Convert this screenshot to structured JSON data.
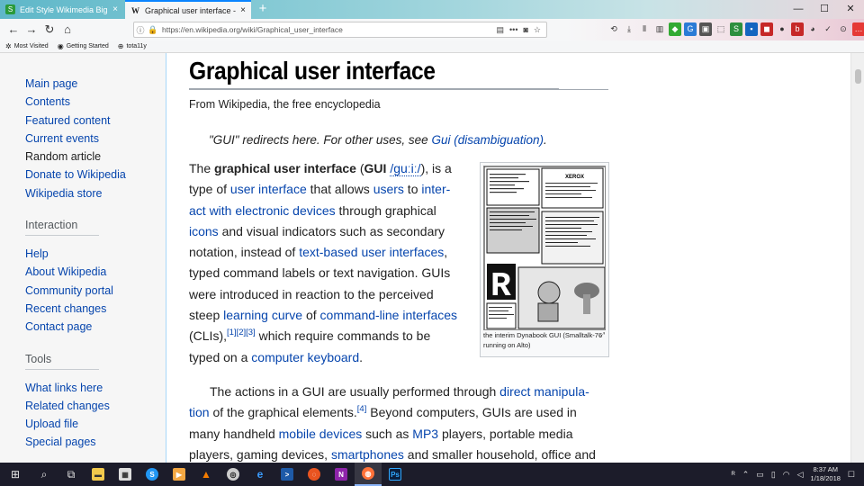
{
  "browser": {
    "tabs": [
      {
        "label": "Edit Style Wikimedia Big Fonts",
        "close": "×",
        "active": false
      },
      {
        "label": "Graphical user interface - Wikip",
        "close": "×",
        "active": true
      }
    ],
    "new_tab": "+",
    "window_controls": {
      "minimize": "—",
      "maximize": "☐",
      "close": "✕"
    },
    "url": "https://en.wikipedia.org/wiki/Graphical_user_interface",
    "url_more": "•••",
    "bookmarks": [
      "Most Visited",
      "Getting Started",
      "tota11y"
    ],
    "accent": "#0a84ff"
  },
  "sidebar": {
    "nav": [
      "Main page",
      "Contents",
      "Featured content",
      "Current events",
      "Random article",
      "Donate to Wikipedia",
      "Wikipedia store"
    ],
    "interaction_heading": "Interaction",
    "interaction": [
      "Help",
      "About Wikipedia",
      "Community portal",
      "Recent changes",
      "Contact page"
    ],
    "tools_heading": "Tools",
    "tools": [
      "What links here",
      "Related changes",
      "Upload file",
      "Special pages"
    ]
  },
  "article": {
    "title": "Graphical user interface",
    "from": "From Wikipedia, the free encyclopedia",
    "hatnote_pre": "\"GUI\" redirects here. For other uses, see ",
    "hatnote_link": "Gui (disambiguation)",
    "hatnote_post": ".",
    "p1": {
      "l1_a": "The ",
      "l1_b": "graphical user interface",
      "l1_c": " (",
      "l1_d": "GUI",
      "l1_e": " ",
      "l1_f": "/ɡuːiː/",
      "l1_g": "), is a",
      "l2_a": "type of ",
      "l2_b": "user interface",
      "l2_c": " that allows ",
      "l2_d": "users",
      "l2_e": " to ",
      "l2_f": "inter-",
      "l3_a": "act with electronic devices",
      "l3_b": " through graphical",
      "l4_a": "icons",
      "l4_b": " and visual indicators such as secondary",
      "l5_a": "notation, instead of ",
      "l5_b": "text-based user interfaces",
      "l5_c": ",",
      "l6": "typed command labels or text navigation. GUIs",
      "l7": "were introduced in reaction to the perceived",
      "l8_a": "steep ",
      "l8_b": "learning curve",
      "l8_c": " of ",
      "l8_d": "command-line interfaces",
      "l9_a": "(CLIs),",
      "l9_r1": "[1]",
      "l9_r2": "[2]",
      "l9_r3": "[3]",
      "l9_b": " which require commands to be",
      "l10_a": "typed on a ",
      "l10_b": "computer keyboard",
      "l10_c": "."
    },
    "p2": {
      "l1_a": "The actions in a GUI are usually performed through ",
      "l1_b": "direct manipula-",
      "l2_a": "tion",
      "l2_b": " of the graphical elements.",
      "l2_r": "[4]",
      "l2_c": " Beyond computers, GUIs are used in",
      "l3_a": "many handheld ",
      "l3_b": "mobile devices",
      "l3_c": " such as ",
      "l3_d": "MP3",
      "l3_e": " players, portable media",
      "l4_a": "players, gaming devices, ",
      "l4_b": "smartphones",
      "l4_c": " and smaller household, office and"
    },
    "figure": {
      "caption": "the interim Dynabook GUI (Smalltalk-76 running on Alto)",
      "logo_text": "XEROX",
      "big_letter": "R"
    }
  },
  "taskbar": {
    "time": "8:37 AM",
    "date": "1/18/2018"
  },
  "colors": {
    "link": "#0645ad",
    "text": "#222222",
    "sidebar_bg": "#f6f6f6",
    "content_border": "#a7d7f9",
    "taskbar": "#1c1c2a"
  }
}
